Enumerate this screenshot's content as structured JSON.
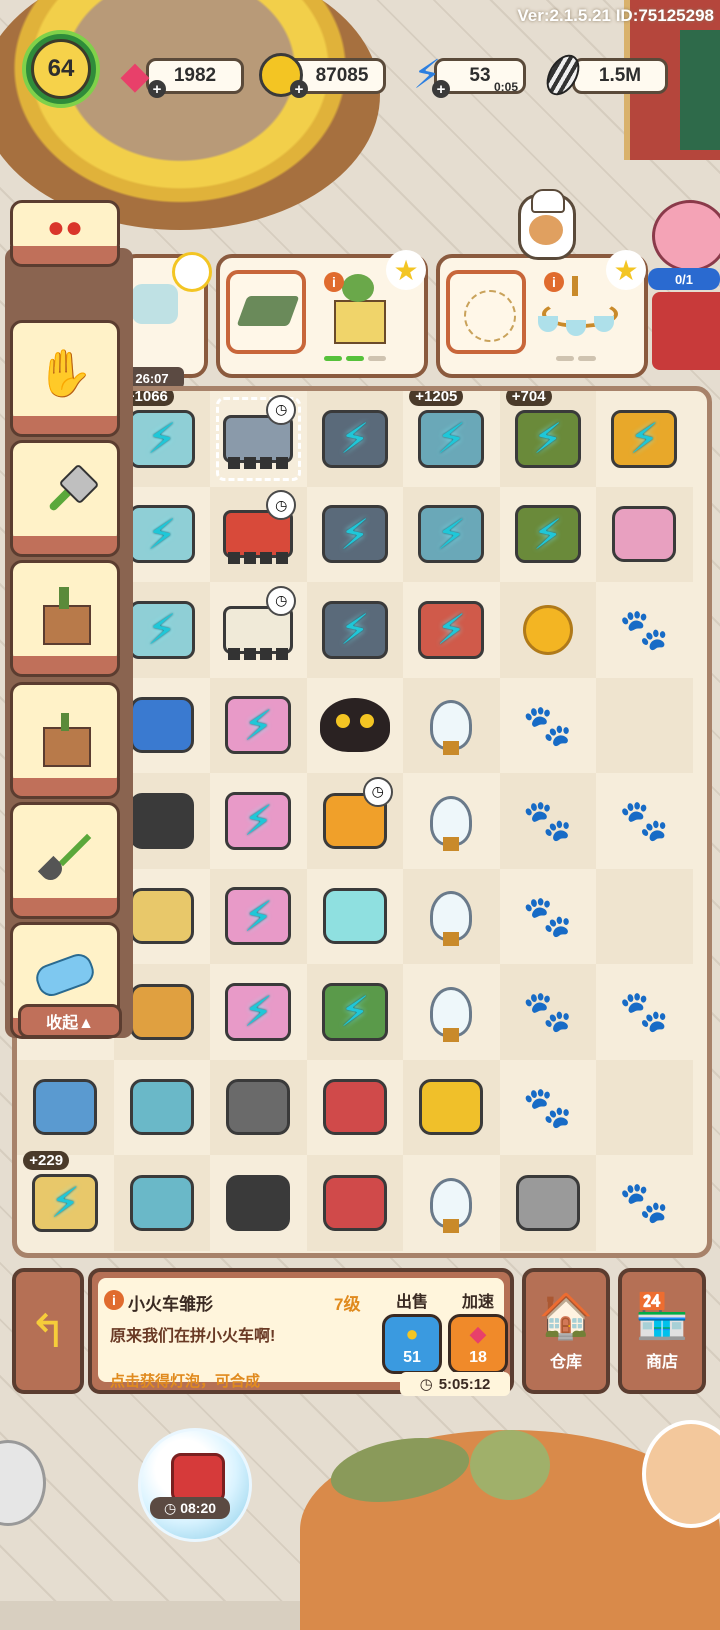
{
  "version": "Ver:2.1.5.21 ID:75125298",
  "topbar": {
    "level": "64",
    "gems": "1982",
    "coins": "87085",
    "energy": "53",
    "energy_timer": "0:05",
    "seeds": "1.5M"
  },
  "orders": {
    "timer": "26:07",
    "piggy_count": "0/1"
  },
  "board": {
    "badges": [
      "+1066",
      "+1205",
      "+704",
      "+229"
    ]
  },
  "side_panel": {
    "collapse_label": "收起▲"
  },
  "item_info": {
    "title": "小火车雏形",
    "level": "7级",
    "description": "原来我们在拼小火车啊!",
    "hint": "点击获得灯泡，可合成",
    "sell_label": "出售",
    "sell_value": "51",
    "speed_label": "加速",
    "speed_value": "18",
    "timer": "5:05:12"
  },
  "buttons": {
    "warehouse": "仓库",
    "shop": "商店"
  },
  "bottom": {
    "bubble_timer": "08:20"
  },
  "colors": {
    "accent_orange": "#e08a1e",
    "energy_cyan": "#1fc7d8",
    "panel_brown": "#b57055"
  }
}
